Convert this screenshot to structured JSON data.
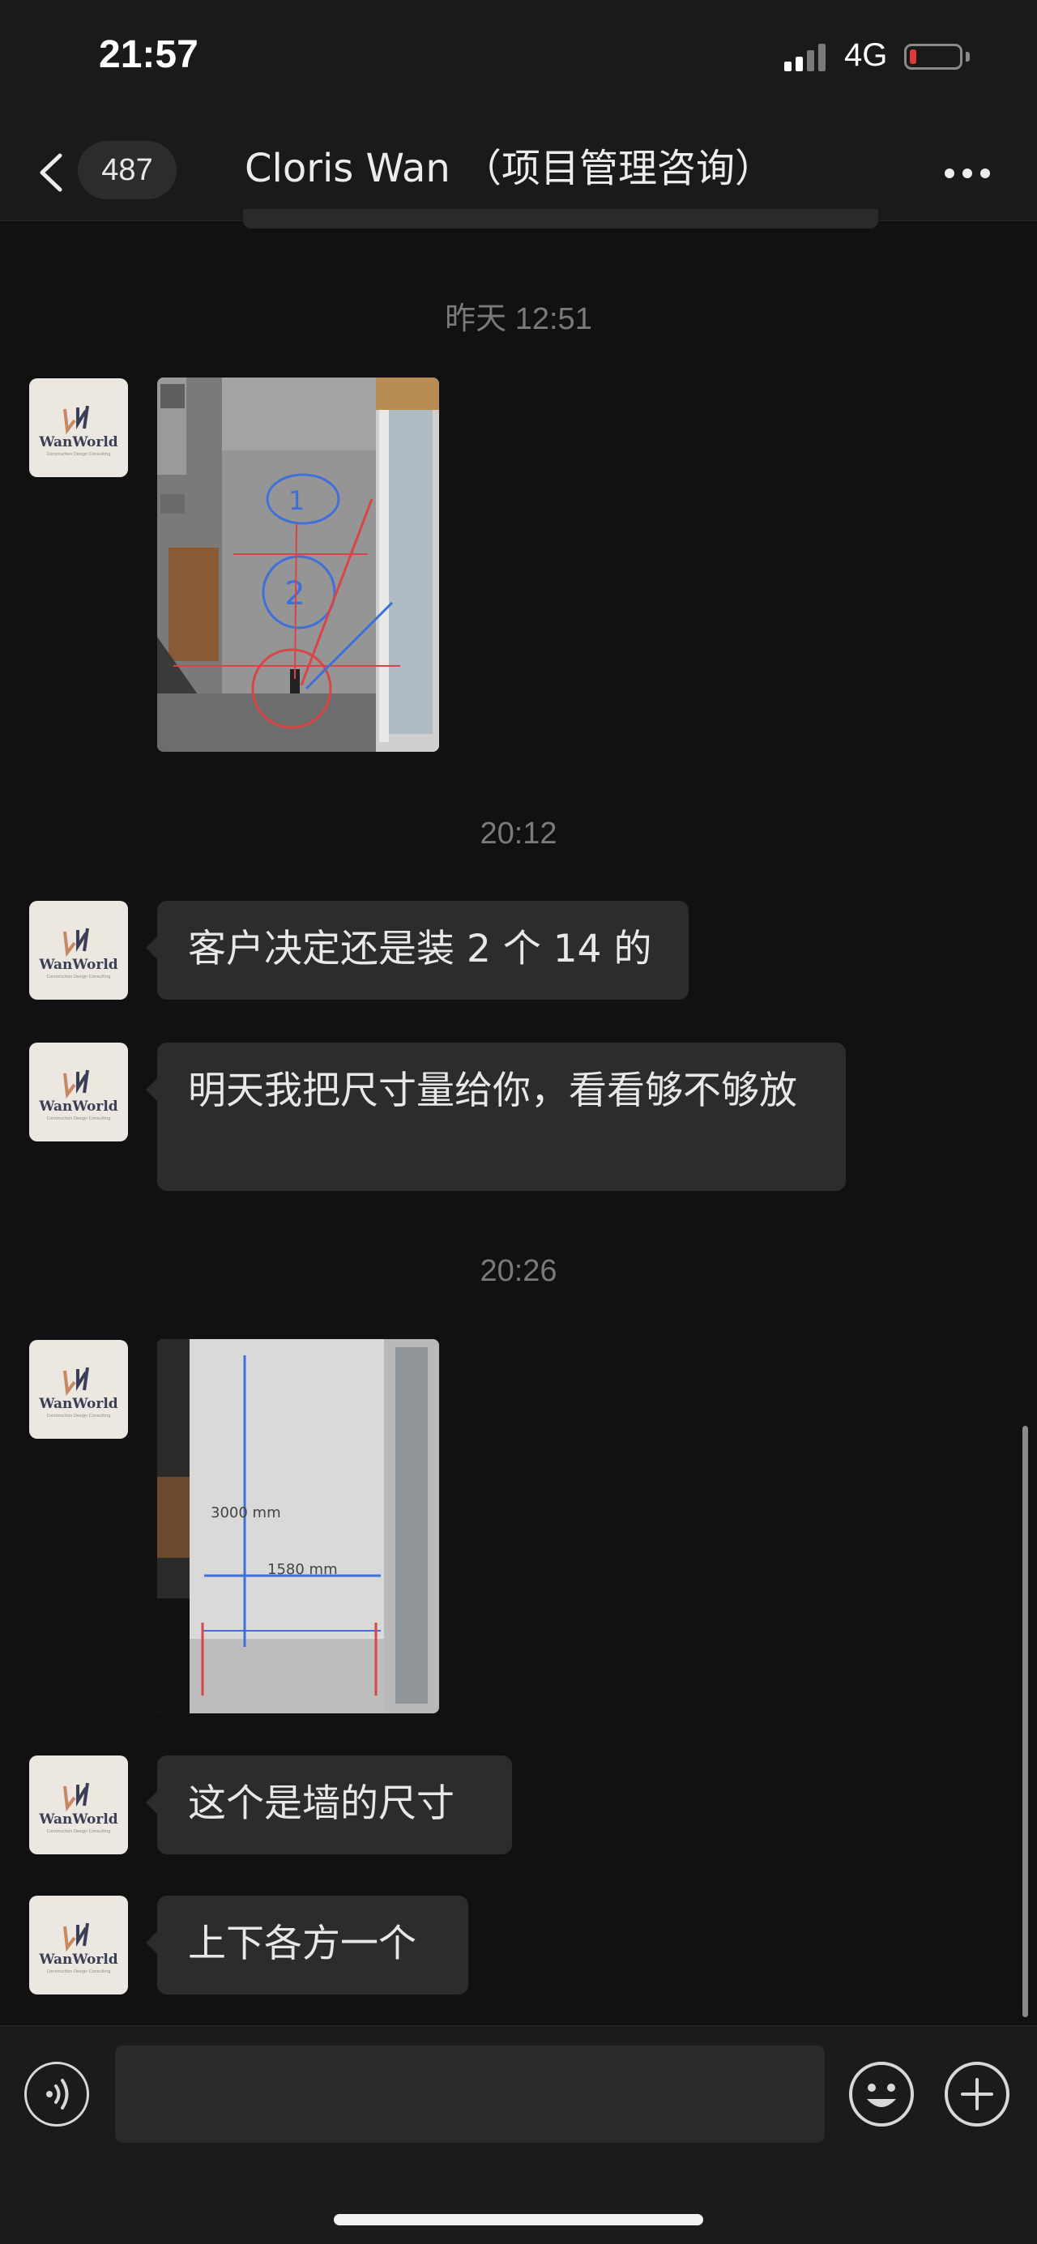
{
  "status_bar": {
    "time": "21:57",
    "network": "4G"
  },
  "nav": {
    "back_icon": "chevron-left-icon",
    "unread_count": "487",
    "title": "Cloris Wan （项目管理咨询）",
    "more_icon": "more-dots-icon"
  },
  "avatar": {
    "logo_text": "WanWorld",
    "logo_subtext": "Construction Design Consulting"
  },
  "messages": [
    {
      "type": "timestamp",
      "text": "昨天 12:51"
    },
    {
      "type": "image",
      "content": "Photo of an exterior wall with blue circled markers 1 and 2 and red reference lines"
    },
    {
      "type": "timestamp",
      "text": "20:12"
    },
    {
      "type": "text",
      "text": "客户决定还是装 2 个 14 的"
    },
    {
      "type": "text",
      "text": "明天我把尺寸量给你，看看够不够放"
    },
    {
      "type": "timestamp",
      "text": "20:26"
    },
    {
      "type": "image",
      "content": "Photo of wall with dimension annotations",
      "labels": [
        "3000 mm",
        "1580 mm"
      ]
    },
    {
      "type": "text",
      "text": "这个是墙的尺寸"
    },
    {
      "type": "text",
      "text": "上下各方一个"
    }
  ],
  "photo1_labels": [
    "1",
    "2"
  ],
  "input": {
    "value": "",
    "voice_icon": "voice-icon",
    "emoji_icon": "emoji-icon",
    "plus_icon": "plus-icon"
  },
  "colors": {
    "background": "#111111",
    "bar": "#1a1a1a",
    "bubble": "#2c2c2c",
    "text": "#e8e8e8",
    "timestamp": "#7a7a7a",
    "battery_low": "#e23a3a",
    "annotation_blue": "#3f6fd8",
    "annotation_red": "#d94545"
  }
}
